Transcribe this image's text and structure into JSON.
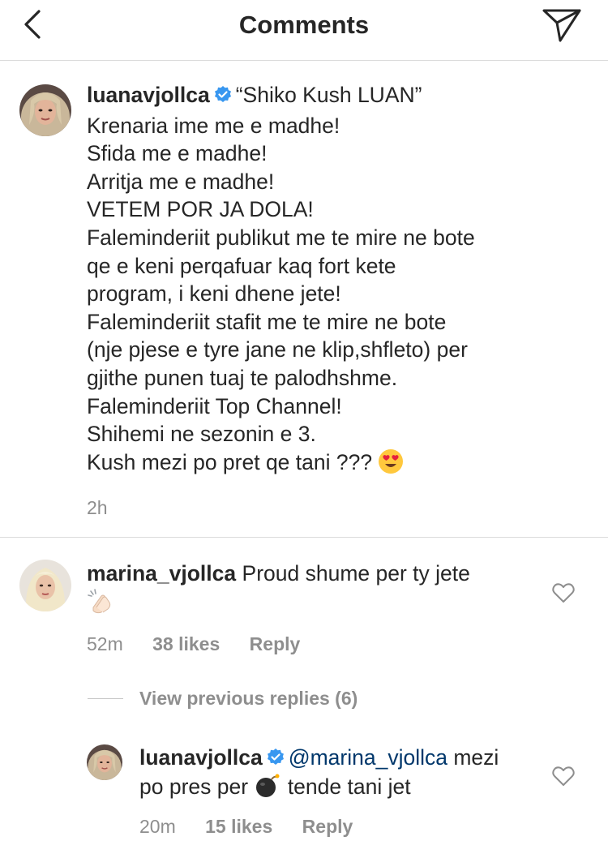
{
  "header": {
    "title": "Comments",
    "back_icon": "chevron-left-icon",
    "send_icon": "paper-plane-icon"
  },
  "caption": {
    "username": "luanavjollca",
    "verified_icon": "verified-badge-icon",
    "first_line": "“Shiko Kush LUAN”",
    "lines": [
      "Krenaria ime me e madhe!",
      "Sfida me e madhe!",
      "Arritja me e madhe!",
      "VETEM POR JA DOLA!",
      "Faleminderiit publikut me te mire ne bote",
      "qe e keni perqafuar kaq fort kete",
      "program, i keni dhene jete!",
      "Faleminderiit stafit me te mire ne bote",
      "(nje pjese e tyre jane ne klip,shfleto) per",
      "gjithe punen tuaj te palodhshme.",
      "Faleminderiit Top Channel!",
      "Shihemi ne sezonin e 3."
    ],
    "last_line": "Kush mezi po pret qe tani ???",
    "last_emoji": "heart-eyes-emoji",
    "time": "2h"
  },
  "comments": [
    {
      "username": "marina_vjollca",
      "text": "Proud shume per ty jete",
      "emoji": "clapping-hands-emoji",
      "time": "52m",
      "likes": "38 likes",
      "reply": "Reply",
      "like_icon": "heart-outline-icon"
    }
  ],
  "view_replies": "View previous replies (6)",
  "replies": [
    {
      "username": "luanavjollca",
      "mention": "@marina_vjollca",
      "text_part1": "mezi",
      "text_part2": "po pres per",
      "text_part3": "tende tani jet",
      "emoji": "bomb-emoji",
      "time": "20m",
      "likes": "15 likes",
      "reply": "Reply",
      "like_icon": "heart-outline-icon"
    }
  ],
  "colors": {
    "text": "#262626",
    "secondary": "#8e8e8e",
    "divider": "#dbdbdb",
    "verified": "#3897f0",
    "mention": "#00376b"
  }
}
